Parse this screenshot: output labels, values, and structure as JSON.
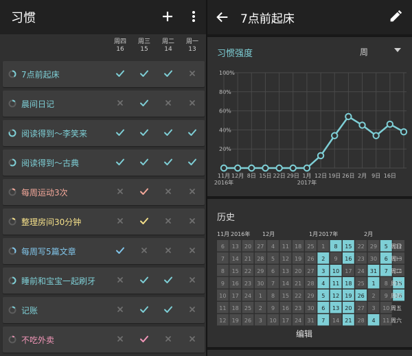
{
  "app": {
    "title": "习惯",
    "add_icon": "plus-icon",
    "menu_icon": "more-vert-icon"
  },
  "days": [
    {
      "weekday": "周四",
      "date": "16"
    },
    {
      "weekday": "周三",
      "date": "15"
    },
    {
      "weekday": "周二",
      "date": "14"
    },
    {
      "weekday": "周一",
      "date": "13"
    }
  ],
  "colors": {
    "teal": "#7ecfd6",
    "blue": "#81c5ea",
    "salmon": "#f4a89a",
    "yellow": "#f5e08a",
    "pink": "#f397b9",
    "gray": "#777777",
    "accent": "#7ecfd6"
  },
  "habits": [
    {
      "name": "7点前起床",
      "color": "#7ecfd6",
      "strength": 0.4,
      "checks": [
        true,
        true,
        true,
        false
      ]
    },
    {
      "name": "晨间日记",
      "color": "#7ecfd6",
      "strength": 0.15,
      "checks": [
        false,
        true,
        false,
        false
      ]
    },
    {
      "name": "阅读得到～李笑来",
      "color": "#7ecfd6",
      "strength": 0.8,
      "checks": [
        true,
        true,
        true,
        true
      ]
    },
    {
      "name": "阅读得到～古典",
      "color": "#7ecfd6",
      "strength": 0.6,
      "checks": [
        true,
        true,
        true,
        true
      ]
    },
    {
      "name": "每周运动3次",
      "color": "#f4a89a",
      "strength": 0.15,
      "checks": [
        false,
        true,
        false,
        false
      ]
    },
    {
      "name": "整理房间30分钟",
      "color": "#f5e08a",
      "strength": 0.15,
      "checks": [
        false,
        true,
        false,
        false
      ]
    },
    {
      "name": "每周写5篇文章",
      "color": "#81c5ea",
      "strength": 0.35,
      "checks": [
        true,
        false,
        false,
        false
      ]
    },
    {
      "name": "睡前和宝宝一起刷牙",
      "color": "#7ecfd6",
      "strength": 0.5,
      "checks": [
        false,
        true,
        true,
        false
      ]
    },
    {
      "name": "记账",
      "color": "#7ecfd6",
      "strength": 0.15,
      "checks": [
        false,
        true,
        true,
        false
      ]
    },
    {
      "name": "不吃外卖",
      "color": "#f397b9",
      "strength": 0.1,
      "checks": [
        false,
        true,
        false,
        false
      ]
    }
  ],
  "detail": {
    "title": "7点前起床",
    "back_icon": "arrow-back-icon",
    "edit_icon": "pencil-icon",
    "strength_title": "习惯强度",
    "period": "周",
    "period_arrow_icon": "dropdown-arrow-icon",
    "history_title": "历史",
    "edit_label": "编辑"
  },
  "chart_data": {
    "type": "line",
    "y_ticks": [
      "100%",
      "80%",
      "60%",
      "40%",
      "20%"
    ],
    "ylim": [
      0,
      100
    ],
    "x_labels": [
      "11月",
      "12月",
      "8日",
      "15日",
      "22日",
      "29日",
      "1月",
      "12日",
      "19日",
      "26日",
      "2月",
      "9日",
      "16日"
    ],
    "year_labels": [
      "2016年",
      "2017年"
    ],
    "values": [
      0,
      0,
      0,
      0,
      0,
      0,
      0,
      13,
      34,
      54,
      45,
      34,
      46,
      38
    ],
    "grid": true,
    "color": "#7ecfd6"
  },
  "history": {
    "month_labels": [
      "11月",
      "2016年",
      "12月",
      "1月",
      "2017年",
      "2月"
    ],
    "row_labels": [
      "周日",
      "周一",
      "周二",
      "周三",
      "周四",
      "周五",
      "周六"
    ],
    "weeks": [
      [
        6,
        7,
        8,
        9,
        10,
        11,
        12
      ],
      [
        13,
        14,
        15,
        16,
        17,
        18,
        19
      ],
      [
        20,
        21,
        22,
        23,
        24,
        25,
        26
      ],
      [
        27,
        28,
        29,
        30,
        1,
        2,
        3
      ],
      [
        4,
        5,
        6,
        7,
        8,
        9,
        10
      ],
      [
        11,
        12,
        13,
        14,
        15,
        16,
        17
      ],
      [
        18,
        19,
        20,
        21,
        22,
        23,
        24
      ],
      [
        25,
        26,
        27,
        28,
        29,
        30,
        31
      ],
      [
        1,
        2,
        3,
        4,
        5,
        6,
        7
      ],
      [
        8,
        9,
        10,
        11,
        12,
        13,
        14
      ],
      [
        15,
        16,
        17,
        18,
        19,
        20,
        21
      ],
      [
        22,
        23,
        24,
        25,
        26,
        27,
        28
      ],
      [
        29,
        30,
        31,
        1,
        2,
        3,
        4
      ],
      [
        5,
        6,
        7,
        8,
        9,
        10,
        11
      ],
      [
        12,
        13,
        14,
        15,
        16,
        null,
        null
      ]
    ],
    "done": [
      [
        8,
        1
      ],
      [
        8,
        2
      ],
      [
        8,
        3
      ],
      [
        8,
        4
      ],
      [
        8,
        5
      ],
      [
        8,
        6
      ],
      [
        8,
        7
      ],
      [
        9,
        0
      ],
      [
        9,
        2
      ],
      [
        9,
        3
      ],
      [
        9,
        4
      ],
      [
        9,
        5
      ],
      [
        10,
        0
      ],
      [
        10,
        1
      ],
      [
        10,
        3
      ],
      [
        10,
        4
      ],
      [
        10,
        5
      ],
      [
        10,
        6
      ],
      [
        11,
        4
      ],
      [
        12,
        2
      ],
      [
        12,
        3
      ],
      [
        12,
        6
      ],
      [
        13,
        0
      ],
      [
        13,
        1
      ],
      [
        13,
        2
      ],
      [
        14,
        3
      ],
      [
        14,
        4
      ]
    ],
    "on_color": "#7ecfd6",
    "off_color": "#4a4a4a"
  }
}
